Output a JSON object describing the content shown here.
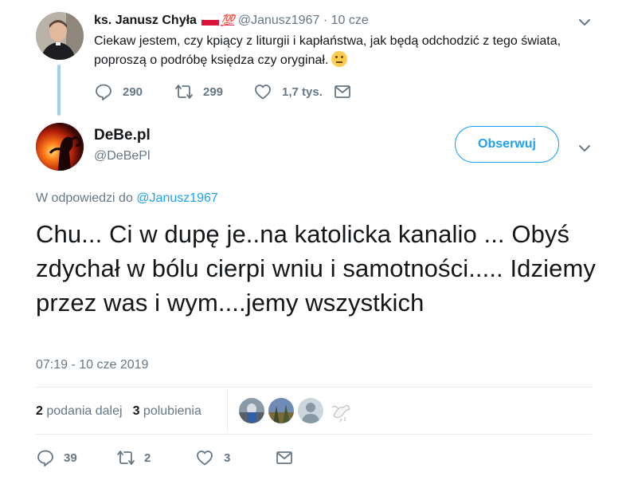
{
  "parent_tweet": {
    "author_name": "ks. Janusz Chyła",
    "badge_emoji": "💯",
    "handle": "@Janusz1967",
    "separator": "·",
    "time": "10 cze",
    "text": "Ciekaw jestem, czy kpiący z liturgii i kapłaństwa, jak będą odchodzić z tego świata, poproszą o podróbę księdza czy oryginał.",
    "emoji": "thinking-face-icon",
    "replies": "290",
    "retweets": "299",
    "likes": "1,7 tys."
  },
  "main_tweet": {
    "author_name": "DeBe.pl",
    "handle": "@DeBePl",
    "follow_label": "Obserwuj",
    "reply_prefix": "W odpowiedzi do",
    "reply_to": "@Janusz1967",
    "text": "Chu... Ci w dupę je..na katolicka kanalio ... Obyś zdychał w bólu cierpi wniu i samotności..... Idziemy przez was i wym....jemy wszystkich",
    "timestamp": "07:19 - 10 cze 2019",
    "retweet_count": "2",
    "retweet_label": "podania dalej",
    "like_count": "3",
    "like_label": "polubienia",
    "replies": "39",
    "retweets": "2",
    "likes": "3"
  },
  "colors": {
    "accent": "#1da1f2",
    "muted": "#657786",
    "text": "#14171a",
    "thread_line": "#9ed2ee",
    "divider": "#e6ecf0"
  }
}
